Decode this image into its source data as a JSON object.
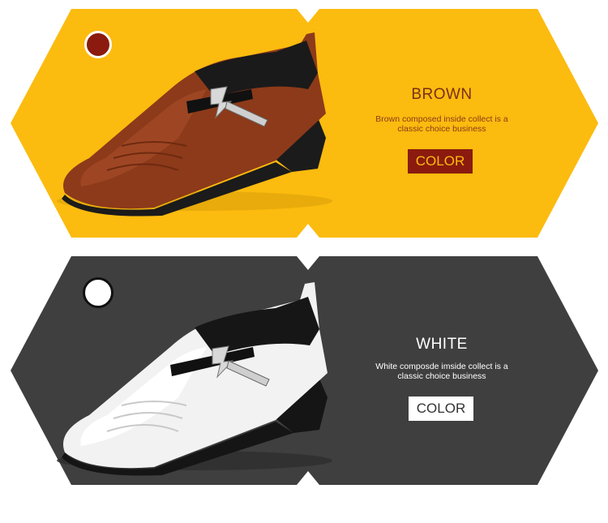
{
  "colors": {
    "panel_brown": "#fcbb0f",
    "panel_white": "#3f3f3f",
    "brown_swatch": "#8a1b0e"
  },
  "panels": [
    {
      "title": "BROWN",
      "description_line1": "Brown composed inside collect is a",
      "description_line2": "classic choice business",
      "button_label": "COLOR",
      "swatch_color": "brown-swatch"
    },
    {
      "title": "WHITE",
      "description_line1": "White composde imside collect is a",
      "description_line2": "classic choice business",
      "button_label": "COLOR",
      "swatch_color": "white-swatch"
    }
  ]
}
